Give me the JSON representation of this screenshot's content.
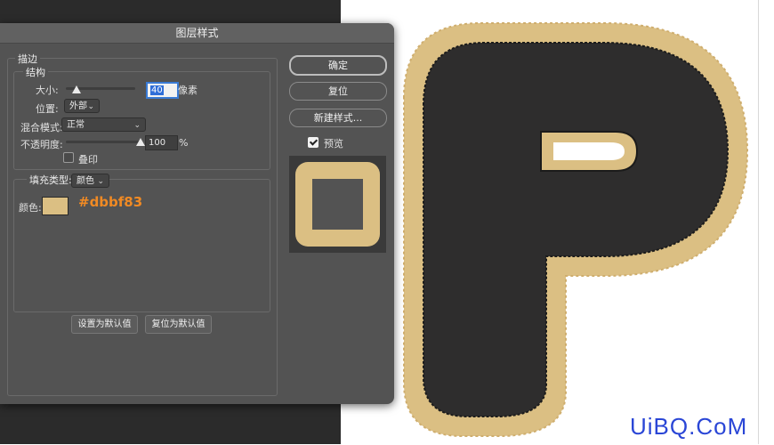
{
  "dialog": {
    "title": "图层样式",
    "stroke_section": "描边",
    "structure_section": "结构",
    "size_label": "大小:",
    "size_value": "40",
    "size_unit": "像素",
    "size_slider": 0.16,
    "position_label": "位置:",
    "position_value": "外部",
    "blend_mode_label": "混合模式:",
    "blend_mode_value": "正常",
    "opacity_label": "不透明度:",
    "opacity_value": "100",
    "opacity_unit": "%",
    "opacity_slider": 1.0,
    "overprint_label": "叠印",
    "overprint_checked": false,
    "fill_type_label": "填充类型:",
    "fill_type_value": "颜色",
    "color_label": "颜色:",
    "color_value": "#dbbf83",
    "color_callout": "#dbbf83",
    "make_default_button": "设置为默认值",
    "reset_default_button": "复位为默认值"
  },
  "side_buttons": {
    "ok": "确定",
    "reset": "复位",
    "new_style": "新建样式...",
    "preview_label": "预览",
    "preview_checked": true
  },
  "canvas": {
    "letter": "P",
    "fill_color": "#2e2d2d",
    "stroke_color": "#dbbf83"
  },
  "watermark": "UiBQ.CoM",
  "colors": {
    "dialog_bg": "#535353",
    "accent_orange": "#f08a24",
    "watermark_blue": "#2a46d6"
  }
}
